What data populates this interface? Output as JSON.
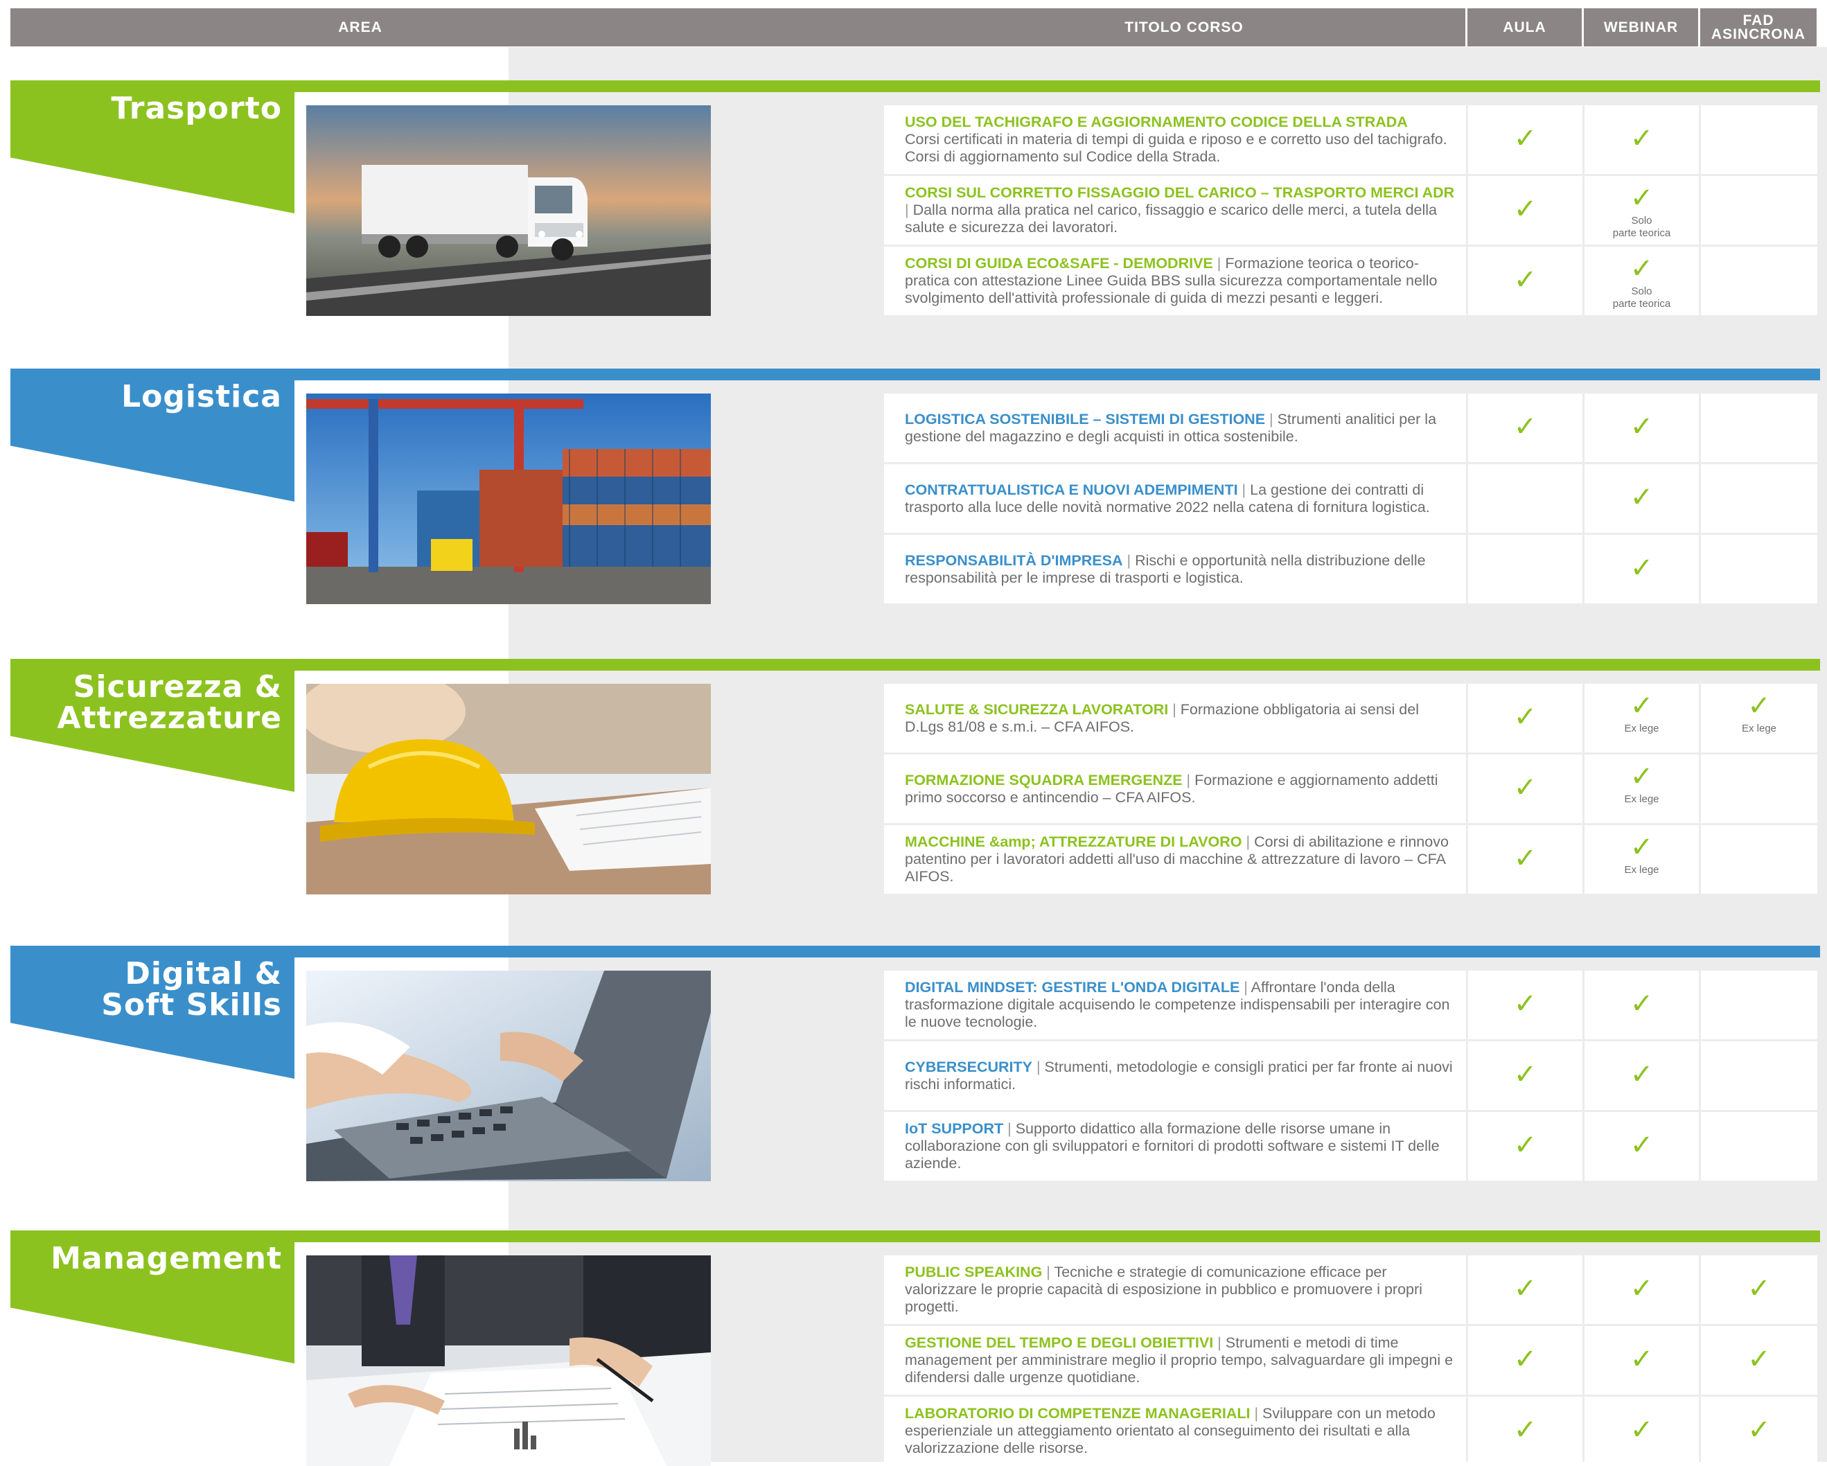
{
  "header": {
    "area": "AREA",
    "titolo": "TITOLO CORSO",
    "aula": "AULA",
    "webinar": "WEBINAR",
    "fad_line1": "FAD",
    "fad_line2": "ASINCRONA"
  },
  "colors": {
    "green": "#8cc21f",
    "blue": "#3a8fcb",
    "header_gray": "#8b8685",
    "panel_gray": "#ececec"
  },
  "check_glyph": "✓",
  "sections": [
    {
      "title_lines": [
        "Trasporto"
      ],
      "color": "green",
      "photo": "truck-highway-photo",
      "courses": [
        {
          "title": "USO DEL TACHIGRAFO E AGGIORNAMENTO CODICE DELLA STRADA",
          "separator": "",
          "desc": "Corsi certificati in materia di tempi di guida e riposo e e corretto uso del tachigrafo. Corsi di aggiornamento sul Codice della Strada.",
          "aula": true,
          "webinar": true,
          "webinar_note": [],
          "fad": false,
          "fad_note": []
        },
        {
          "title": "CORSI SUL CORRETTO FISSAGGIO DEL CARICO – TRASPORTO MERCI ADR",
          "separator": " | ",
          "desc": "Dalla norma alla pratica nel carico, fissaggio e scarico delle merci, a tutela della salute e sicurezza dei lavoratori.",
          "aula": true,
          "webinar": true,
          "webinar_note": [
            "Solo",
            "parte teorica"
          ],
          "fad": false,
          "fad_note": []
        },
        {
          "title": "CORSI DI GUIDA ECO&SAFE - DEMODRIVE",
          "separator": " | ",
          "desc": "Formazione teorica o teorico-pratica con attestazione Linee Guida BBS sulla sicurezza comportamentale nello svolgimento dell'attività professionale di guida di mezzi pesanti e leggeri.",
          "aula": true,
          "webinar": true,
          "webinar_note": [
            "Solo",
            "parte teorica"
          ],
          "fad": false,
          "fad_note": []
        }
      ]
    },
    {
      "title_lines": [
        "Logistica"
      ],
      "color": "blue",
      "photo": "port-containers-photo",
      "courses": [
        {
          "title": "LOGISTICA SOSTENIBILE – SISTEMI DI GESTIONE",
          "separator": " | ",
          "desc": "Strumenti analitici per la gestione del magazzino e degli acquisti in ottica sostenibile.",
          "aula": true,
          "webinar": true,
          "webinar_note": [],
          "fad": false,
          "fad_note": []
        },
        {
          "title": "CONTRATTUALISTICA E NUOVI ADEMPIMENTI",
          "separator": " | ",
          "desc": "La gestione dei contratti di trasporto alla luce delle novità normative 2022 nella catena di fornitura logistica.",
          "aula": false,
          "webinar": true,
          "webinar_note": [],
          "fad": false,
          "fad_note": []
        },
        {
          "title": "RESPONSABILITÀ D'IMPRESA",
          "separator": " | ",
          "desc": "Rischi e opportunità nella distribuzione delle responsabilità per le imprese di trasporti e logistica.",
          "aula": false,
          "webinar": true,
          "webinar_note": [],
          "fad": false,
          "fad_note": []
        }
      ]
    },
    {
      "title_lines": [
        "Sicurezza &",
        "Attrezzature"
      ],
      "color": "green",
      "photo": "hard-hat-photo",
      "courses": [
        {
          "title": "SALUTE & SICUREZZA LAVORATORI",
          "separator": " | ",
          "desc": "Formazione obbligatoria ai sensi del D.Lgs 81/08 e s.m.i. – CFA AIFOS.",
          "aula": true,
          "webinar": true,
          "webinar_note": [
            "Ex lege"
          ],
          "fad": true,
          "fad_note": [
            "Ex lege"
          ]
        },
        {
          "title": "FORMAZIONE SQUADRA EMERGENZE",
          "separator": " | ",
          "desc": "Formazione e aggiornamento addetti primo soccorso e antincendio – CFA AIFOS.",
          "aula": true,
          "webinar": true,
          "webinar_note": [
            "Ex lege"
          ],
          "fad": false,
          "fad_note": []
        },
        {
          "title": "MACCHINE &amp; ATTREZZATURE DI LAVORO",
          "separator": " | ",
          "desc": "Corsi di abilitazione e rinnovo patentino per i lavoratori addetti all'uso di macchine & attrezzature di lavoro – CFA AIFOS.",
          "aula": true,
          "webinar": true,
          "webinar_note": [
            "Ex lege"
          ],
          "fad": false,
          "fad_note": []
        }
      ]
    },
    {
      "title_lines": [
        "Digital &",
        "Soft Skills"
      ],
      "color": "blue",
      "photo": "laptop-typing-photo",
      "courses": [
        {
          "title": "DIGITAL MINDSET: GESTIRE L'ONDA DIGITALE",
          "separator": " | ",
          "desc": "Affrontare l'onda della trasformazione digitale acquisendo le competenze indispensabili per interagire con le nuove tecnologie.",
          "aula": true,
          "webinar": true,
          "webinar_note": [],
          "fad": false,
          "fad_note": []
        },
        {
          "title": "CYBERSECURITY",
          "separator": " | ",
          "desc": "Strumenti, metodologie e consigli pratici per far fronte ai nuovi rischi informatici.",
          "aula": true,
          "webinar": true,
          "webinar_note": [],
          "fad": false,
          "fad_note": []
        },
        {
          "title": "IoT SUPPORT",
          "separator": " | ",
          "desc": "Supporto didattico alla formazione delle risorse umane in collaborazione con gli sviluppatori e fornitori di prodotti software e sistemi IT delle aziende.",
          "aula": true,
          "webinar": true,
          "webinar_note": [],
          "fad": false,
          "fad_note": []
        }
      ]
    },
    {
      "title_lines": [
        "Management"
      ],
      "color": "green",
      "photo": "business-meeting-photo",
      "courses": [
        {
          "title": "PUBLIC SPEAKING",
          "separator": " | ",
          "desc": "Tecniche e strategie di comunicazione efficace per valorizzare le proprie capacità di esposizione in pubblico e promuovere i propri progetti.",
          "aula": true,
          "webinar": true,
          "webinar_note": [],
          "fad": true,
          "fad_note": []
        },
        {
          "title": "GESTIONE DEL TEMPO E DEGLI OBIETTIVI",
          "separator": " | ",
          "desc": "Strumenti e metodi di time management per amministrare meglio il proprio tempo, salvaguardare gli impegni e difendersi dalle urgenze quotidiane.",
          "aula": true,
          "webinar": true,
          "webinar_note": [],
          "fad": true,
          "fad_note": []
        },
        {
          "title": "LABORATORIO DI COMPETENZE MANAGERIALI",
          "separator": " | ",
          "desc": "Sviluppare con un metodo esperienziale un atteggiamento orientato al conseguimento dei risultati e alla valorizzazione delle risorse.",
          "aula": true,
          "webinar": true,
          "webinar_note": [],
          "fad": true,
          "fad_note": []
        }
      ]
    }
  ]
}
